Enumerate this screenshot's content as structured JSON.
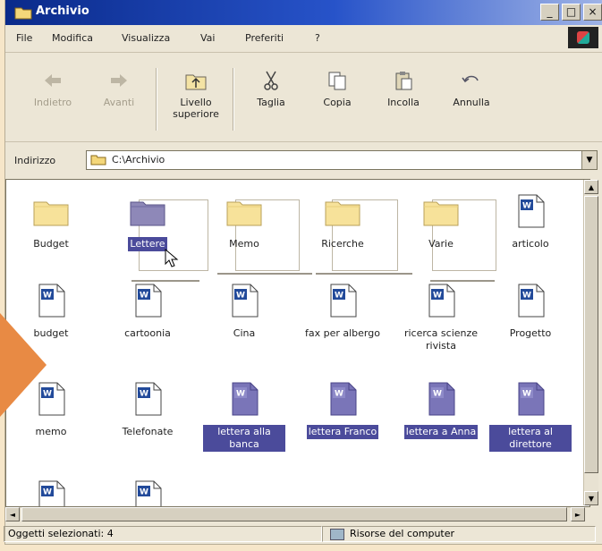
{
  "window": {
    "title": "Archivio",
    "controls": [
      "_",
      "□",
      "×"
    ]
  },
  "menu": [
    "File",
    "Modifica",
    "Visualizza",
    "Vai",
    "Preferiti",
    "?"
  ],
  "toolbar": [
    {
      "label": "Indietro",
      "icon": "back-arrow-icon",
      "enabled": false
    },
    {
      "label": "Avanti",
      "icon": "forward-arrow-icon",
      "enabled": false
    },
    {
      "label": "Livello superiore",
      "icon": "up-folder-icon",
      "enabled": true
    },
    {
      "label": "Taglia",
      "icon": "scissors-icon",
      "enabled": true
    },
    {
      "label": "Copia",
      "icon": "copy-icon",
      "enabled": true
    },
    {
      "label": "Incolla",
      "icon": "paste-icon",
      "enabled": true
    },
    {
      "label": "Annulla",
      "icon": "undo-icon",
      "enabled": true
    }
  ],
  "address": {
    "label": "Indirizzo",
    "value": "C:\\Archivio"
  },
  "items": [
    {
      "name": "Budget",
      "type": "folder",
      "selected": false
    },
    {
      "name": "Lettere",
      "type": "folder",
      "selected": true
    },
    {
      "name": "Memo",
      "type": "folder",
      "selected": false
    },
    {
      "name": "Ricerche",
      "type": "folder",
      "selected": false
    },
    {
      "name": "Varie",
      "type": "folder",
      "selected": false
    },
    {
      "name": "articolo",
      "type": "doc",
      "selected": false
    },
    {
      "name": "budget",
      "type": "doc",
      "selected": false
    },
    {
      "name": "cartoonia",
      "type": "doc",
      "selected": false
    },
    {
      "name": "Cina",
      "type": "doc",
      "selected": false
    },
    {
      "name": "fax per albergo",
      "type": "doc",
      "selected": false
    },
    {
      "name": "ricerca scienze rivista",
      "type": "doc",
      "selected": false
    },
    {
      "name": "Progetto",
      "type": "doc",
      "selected": false
    },
    {
      "name": "memo",
      "type": "doc",
      "selected": false
    },
    {
      "name": "Telefonate",
      "type": "doc",
      "selected": false
    },
    {
      "name": "lettera alla banca",
      "type": "doc",
      "selected": true
    },
    {
      "name": "lettera Franco",
      "type": "doc",
      "selected": true
    },
    {
      "name": "lettera a Anna",
      "type": "doc",
      "selected": true
    },
    {
      "name": "lettera al direttore",
      "type": "doc",
      "selected": true
    },
    {
      "name": "",
      "type": "doc",
      "selected": false
    },
    {
      "name": "",
      "type": "doc",
      "selected": false
    }
  ],
  "status": {
    "selected": "Oggetti selezionati: 4",
    "location": "Risorse del computer"
  }
}
